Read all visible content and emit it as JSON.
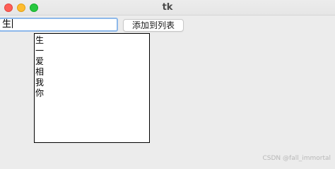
{
  "window": {
    "title": "tk"
  },
  "entry": {
    "value": "生"
  },
  "add_button": {
    "label": "添加到列表"
  },
  "listbox": {
    "items": [
      "生",
      "一",
      "爱",
      "相",
      "我",
      "你"
    ]
  },
  "watermark": {
    "text": "CSDN @fall_immortal"
  },
  "colors": {
    "close": "#fe5f57",
    "minimize": "#febc2e",
    "maximize": "#28c840",
    "focus_ring": "#8db8ea",
    "background": "#ececec"
  }
}
